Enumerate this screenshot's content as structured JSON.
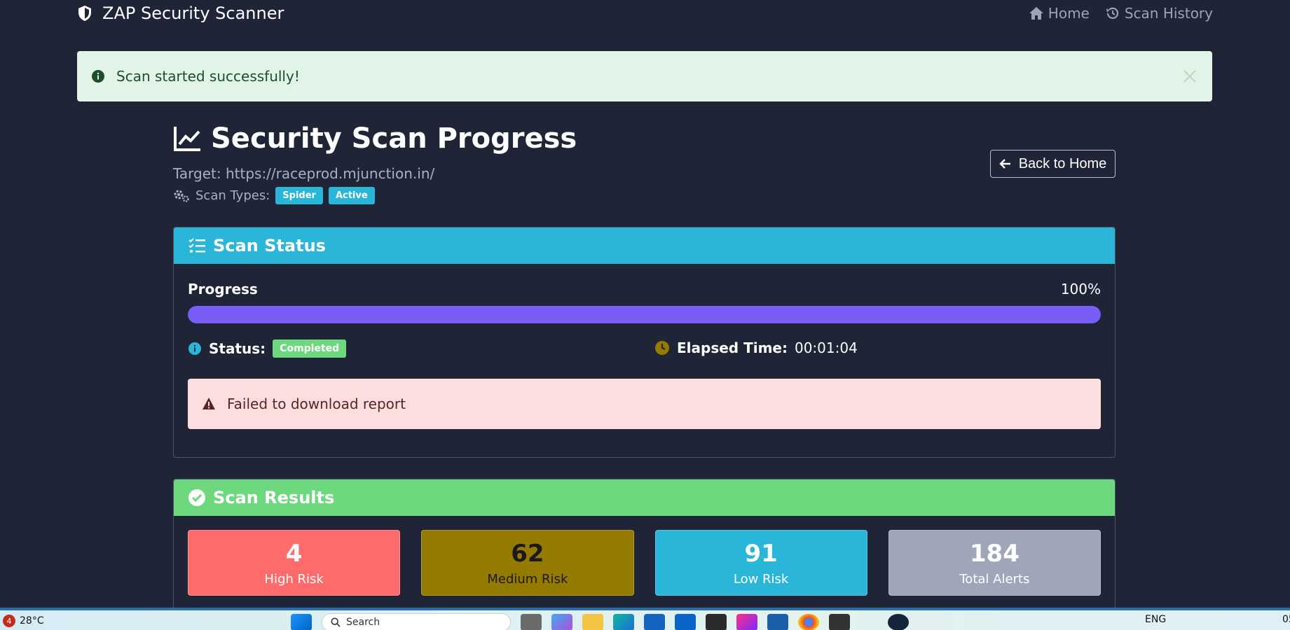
{
  "navbar": {
    "brand": "ZAP Security Scanner",
    "links": [
      {
        "label": "Home",
        "icon": "home-icon"
      },
      {
        "label": "Scan History",
        "icon": "history-icon"
      }
    ]
  },
  "flash": {
    "message": "Scan started successfully!",
    "icon": "info-icon"
  },
  "header": {
    "title": "Security Scan Progress",
    "target": "Target: https://raceprod.mjunction.in/",
    "scan_types_label": "Scan Types:",
    "scan_types": [
      "Spider",
      "Active"
    ],
    "back_button": "Back to Home"
  },
  "status_card": {
    "title": "Scan Status",
    "progress_label": "Progress",
    "progress_value": "100%",
    "progress_fraction": 1.0,
    "status_label": "Status:",
    "status_value": "Completed",
    "elapsed_label": "Elapsed Time:",
    "elapsed_value": "00:01:04",
    "error_message": "Failed to download report"
  },
  "results_card": {
    "title": "Scan Results",
    "stats": [
      {
        "value": "4",
        "label": "High Risk",
        "color": "#ff6b6b"
      },
      {
        "value": "62",
        "label": "Medium Risk",
        "color": "#957a00"
      },
      {
        "value": "91",
        "label": "Low Risk",
        "color": "#29b6d8"
      },
      {
        "value": "184",
        "label": "Total Alerts",
        "color": "#a0a6ba"
      }
    ]
  },
  "taskbar": {
    "notification_count": "4",
    "weather": "28°C",
    "search_placeholder": "Search",
    "language": "ENG",
    "time": "05"
  },
  "colors": {
    "background": "#1f2537",
    "info": "#29b6d8",
    "success": "#6dd87e",
    "progress": "#7a5cf6",
    "danger_bg": "#fddedf"
  }
}
